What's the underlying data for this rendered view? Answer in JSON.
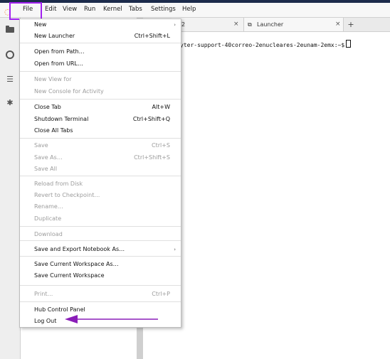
{
  "menubar": {
    "items": [
      "File",
      "Edit",
      "View",
      "Run",
      "Kernel",
      "Tabs",
      "Settings",
      "Help"
    ]
  },
  "tabs": [
    {
      "label": "2",
      "close": "×"
    },
    {
      "label": "Launcher",
      "close": "×"
    }
  ],
  "tab_add": "+",
  "terminal": {
    "prompt": "yter-support-40correo-2enucleares-2eunam-2emx:~$"
  },
  "file_menu": {
    "groups": [
      [
        {
          "label": "New",
          "submenu": true,
          "disabled": false
        },
        {
          "label": "New Launcher",
          "shortcut": "Ctrl+Shift+L",
          "disabled": false
        }
      ],
      [
        {
          "label": "Open from Path…",
          "disabled": false
        },
        {
          "label": "Open from URL…",
          "disabled": false
        }
      ],
      [
        {
          "label": "New View for",
          "disabled": true
        },
        {
          "label": "New Console for Activity",
          "disabled": true
        }
      ],
      [
        {
          "label": "Close Tab",
          "shortcut": "Alt+W",
          "disabled": false
        },
        {
          "label": "Shutdown Terminal",
          "shortcut": "Ctrl+Shift+Q",
          "disabled": false
        },
        {
          "label": "Close All Tabs",
          "disabled": false
        }
      ],
      [
        {
          "label": "Save",
          "shortcut": "Ctrl+S",
          "disabled": true
        },
        {
          "label": "Save As…",
          "shortcut": "Ctrl+Shift+S",
          "disabled": true
        },
        {
          "label": "Save All",
          "disabled": true
        }
      ],
      [
        {
          "label": "Reload from Disk",
          "disabled": true
        },
        {
          "label": "Revert to Checkpoint…",
          "disabled": true
        },
        {
          "label": "Rename…",
          "disabled": true
        },
        {
          "label": "Duplicate",
          "disabled": true
        }
      ],
      [
        {
          "label": "Download",
          "disabled": true
        }
      ],
      [
        {
          "label": "Save and Export Notebook As…",
          "submenu": true,
          "disabled": false
        }
      ],
      [
        {
          "label": "Save Current Workspace As…",
          "disabled": false
        },
        {
          "label": "Save Current Workspace",
          "disabled": false
        }
      ],
      [
        {
          "label": "Print…",
          "shortcut": "Ctrl+P",
          "disabled": true
        }
      ],
      [
        {
          "label": "Hub Control Panel",
          "disabled": false
        },
        {
          "label": "Log Out",
          "disabled": false
        }
      ]
    ]
  },
  "colors": {
    "highlight": "#a020f0",
    "annotation_arrow": "#8a1db8",
    "jupyter_orange": "#f37726"
  },
  "icons": [
    "jupyter-logo-icon",
    "folder-icon",
    "running-circle-icon",
    "list-icon",
    "extension-puzzle-icon",
    "terminal-tab-icon",
    "launcher-tab-icon",
    "submenu-arrow-icon"
  ]
}
